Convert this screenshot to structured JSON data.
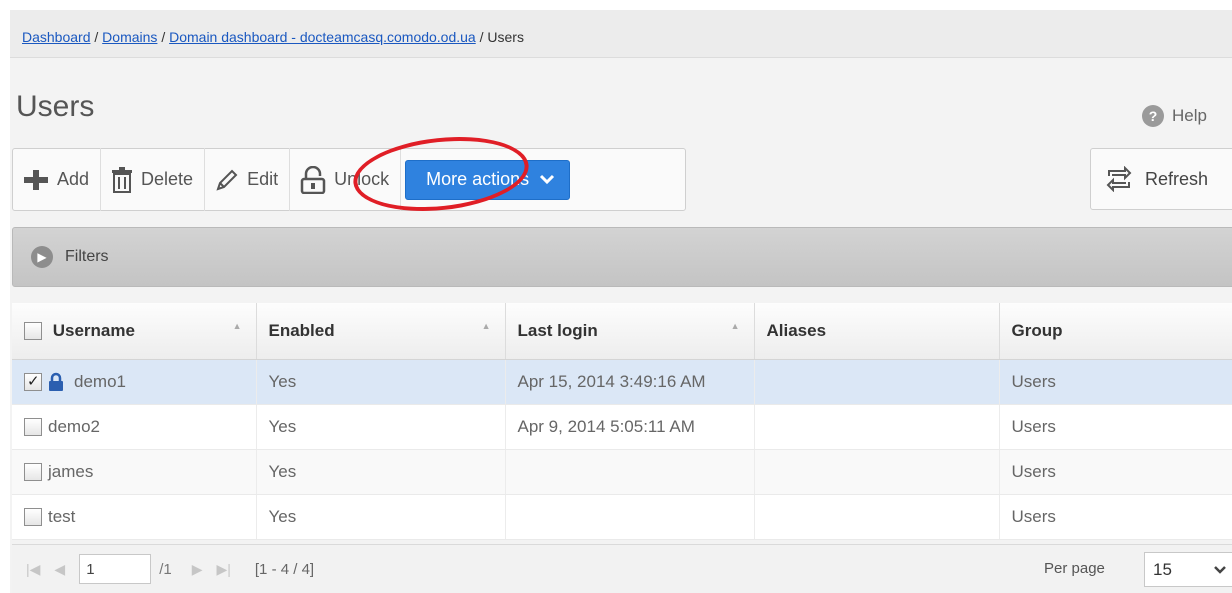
{
  "breadcrumb": {
    "dashboard": "Dashboard",
    "domains": "Domains",
    "domain_dashboard": "Domain dashboard - docteamcasq.comodo.od.ua",
    "current": "Users",
    "sep": "/"
  },
  "page": {
    "title": "Users"
  },
  "help": {
    "label": "Help",
    "glyph": "?"
  },
  "toolbar": {
    "add": "Add",
    "delete": "Delete",
    "edit": "Edit",
    "unlock": "Unlock",
    "more_actions": "More actions"
  },
  "refresh": {
    "label": "Refresh"
  },
  "filters": {
    "label": "Filters"
  },
  "table": {
    "columns": [
      "Username",
      "Enabled",
      "Last login",
      "Aliases",
      "Group"
    ],
    "rows": [
      {
        "username": "demo1",
        "enabled": "Yes",
        "last_login": "Apr 15, 2014 3:49:16 AM",
        "aliases": "",
        "group": "Users",
        "checked": true,
        "locked": true
      },
      {
        "username": "demo2",
        "enabled": "Yes",
        "last_login": "Apr 9, 2014 5:05:11 AM",
        "aliases": "",
        "group": "Users",
        "checked": false,
        "locked": false
      },
      {
        "username": "james",
        "enabled": "Yes",
        "last_login": "",
        "aliases": "",
        "group": "Users",
        "checked": false,
        "locked": false
      },
      {
        "username": "test",
        "enabled": "Yes",
        "last_login": "",
        "aliases": "",
        "group": "Users",
        "checked": false,
        "locked": false
      }
    ]
  },
  "pager": {
    "page": "1",
    "total_pages": "/1",
    "range": "[1 - 4 / 4]",
    "per_page_label": "Per page",
    "per_page": "15"
  },
  "colors": {
    "accent": "#2f82df",
    "highlight": "#e01e26",
    "selected_row": "#dbe7f6",
    "link": "#1a58c0"
  }
}
